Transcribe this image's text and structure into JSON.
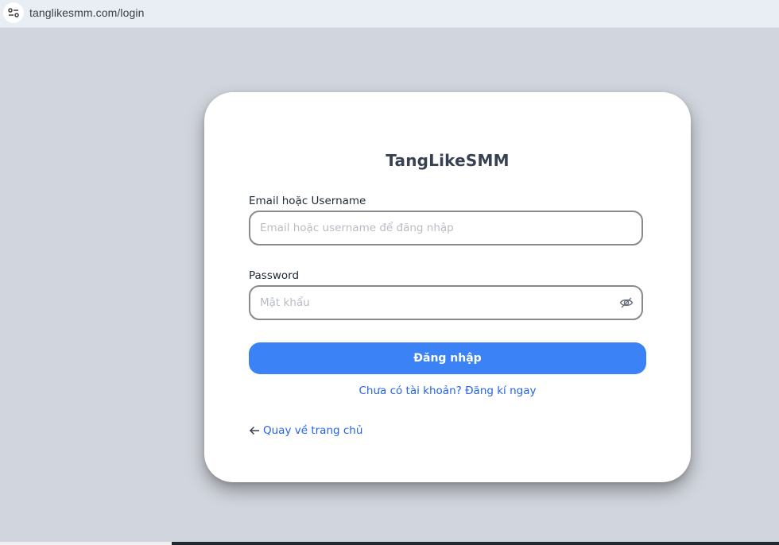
{
  "browser": {
    "url": "tanglikesmm.com/login",
    "site_info_icon": "tune-icon"
  },
  "login": {
    "title": "TangLikeSMM",
    "email_label": "Email hoặc Username",
    "email_placeholder": "Email hoặc username để đăng nhập",
    "email_value": "",
    "password_label": "Password",
    "password_placeholder": "Mật khẩu",
    "password_value": "",
    "password_toggle_icon": "eye-off-icon",
    "submit_label": "Đăng nhập",
    "register_link": "Chưa có tài khoản? Đăng kí ngay",
    "back_link": "Quay về trang chủ",
    "back_icon": "arrow-left-icon"
  },
  "colors": {
    "page_background": "#d1d5dd",
    "accent": "#3b82f6",
    "link": "#2563eb",
    "card": "#ffffff"
  }
}
